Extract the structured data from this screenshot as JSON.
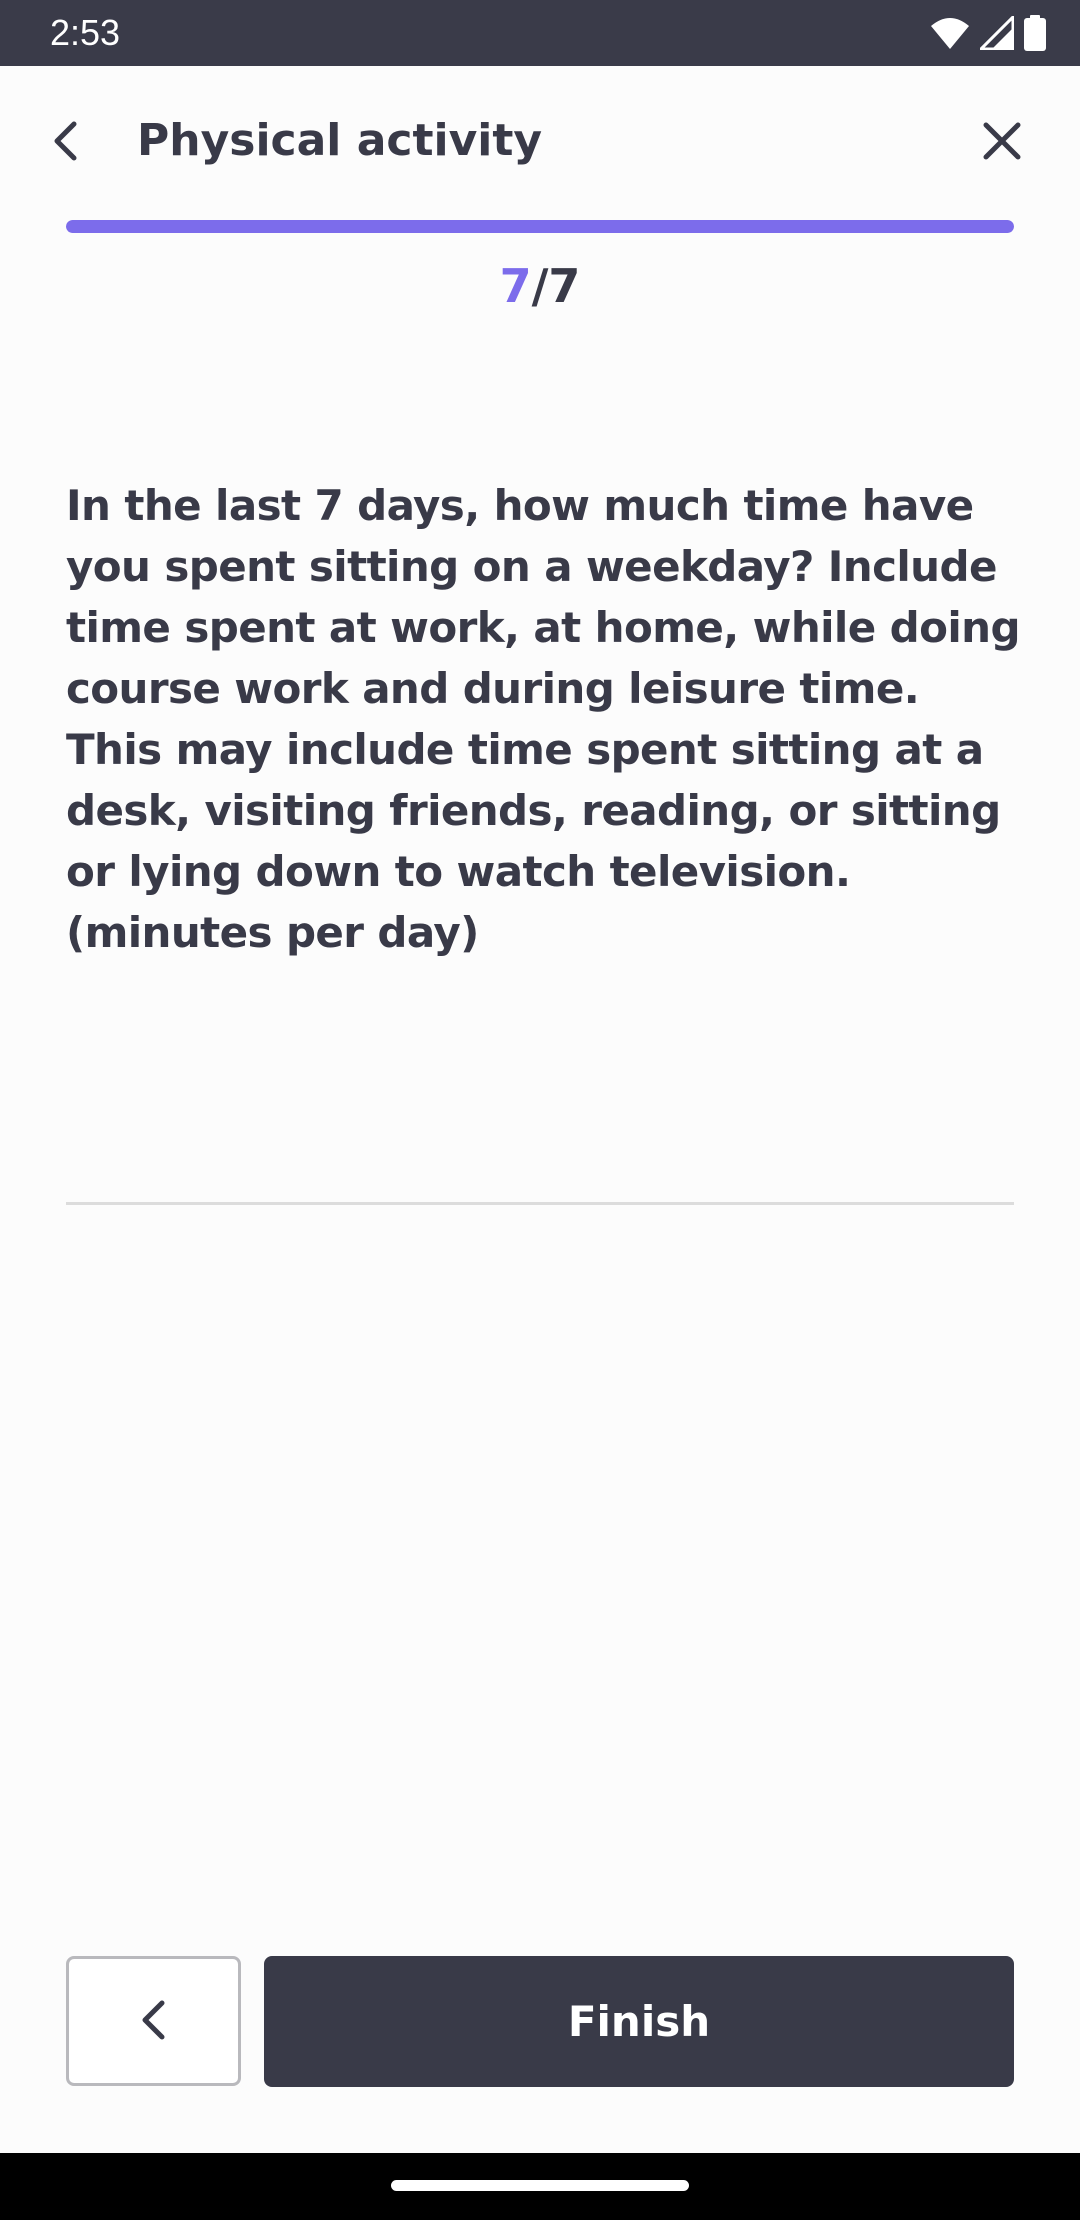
{
  "status_bar": {
    "time": "2:53",
    "icons": [
      "wifi-icon",
      "signal-icon",
      "battery-icon"
    ]
  },
  "header": {
    "title": "Physical activity",
    "back_icon": "chevron-left-icon",
    "close_icon": "close-icon"
  },
  "progress": {
    "current": "7",
    "separator": "/",
    "total": "7",
    "fraction": 1.0,
    "color": "#7c6ceb"
  },
  "question": {
    "text": "In the last 7 days, how much time have you spent sitting on a weekday? Include time spent at work, at home, while doing course work and during leisure time. This may include time spent sitting at a desk, visiting friends, reading, or sitting or lying down to watch television. (minutes per day)"
  },
  "answer": {
    "value": "",
    "placeholder": ""
  },
  "footer": {
    "previous_icon": "chevron-left-icon",
    "finish_label": "Finish"
  },
  "colors": {
    "accent": "#7c6ceb",
    "dark": "#393a48",
    "status_bar": "#3a3b49"
  }
}
